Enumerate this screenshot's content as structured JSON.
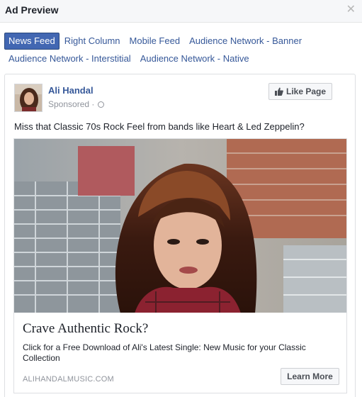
{
  "dialog": {
    "title": "Ad Preview",
    "close_icon": "close-icon"
  },
  "tabs": {
    "row1": [
      {
        "label": "News Feed",
        "active": true
      },
      {
        "label": "Right Column",
        "active": false
      },
      {
        "label": "Mobile Feed",
        "active": false
      },
      {
        "label": "Audience Network - Banner",
        "active": false
      }
    ],
    "row2": [
      {
        "label": "Audience Network - Interstitial",
        "active": false
      },
      {
        "label": "Audience Network - Native",
        "active": false
      }
    ]
  },
  "post": {
    "page_name": "Ali Handal",
    "sponsored": "Sponsored ·",
    "like_button": "Like Page",
    "message": "Miss that Classic 70s Rock Feel from bands like Heart & Led Zeppelin?",
    "link": {
      "title": "Crave Authentic Rock?",
      "description": "Click for a Free Download of Ali's Latest Single: New Music for your Classic Collection",
      "domain": "ALIHANDALMUSIC.COM",
      "cta": "Learn More"
    }
  },
  "colors": {
    "accent": "#4267b2",
    "link": "#365899",
    "muted": "#90949c"
  }
}
